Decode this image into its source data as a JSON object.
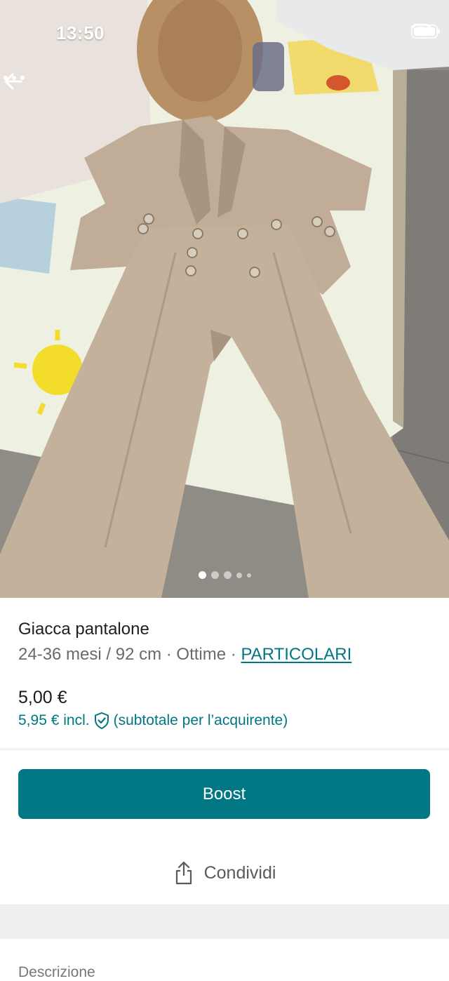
{
  "status_bar": {
    "time": "13:50"
  },
  "top_bar": {
    "back_icon": "arrow-left-icon",
    "more_icon": "more-horizontal-icon"
  },
  "gallery": {
    "photo_count_indicator": 5,
    "active_index": 0
  },
  "item": {
    "title": "Giacca pantalone",
    "size": "24-36 mesi / 92 cm",
    "separator": " · ",
    "condition": "Ottime",
    "details_link": "PARTICOLARI",
    "price": "5,00 €",
    "price_incl": "5,95 € incl.",
    "price_incl_note": "(subtotale per l’acquirente)"
  },
  "actions": {
    "boost_label": "Boost",
    "share_label": "Condividi"
  },
  "description": {
    "heading": "Descrizione"
  },
  "colors": {
    "accent": "#007782",
    "divider": "#e3e3e3",
    "band": "#eef0f0"
  }
}
